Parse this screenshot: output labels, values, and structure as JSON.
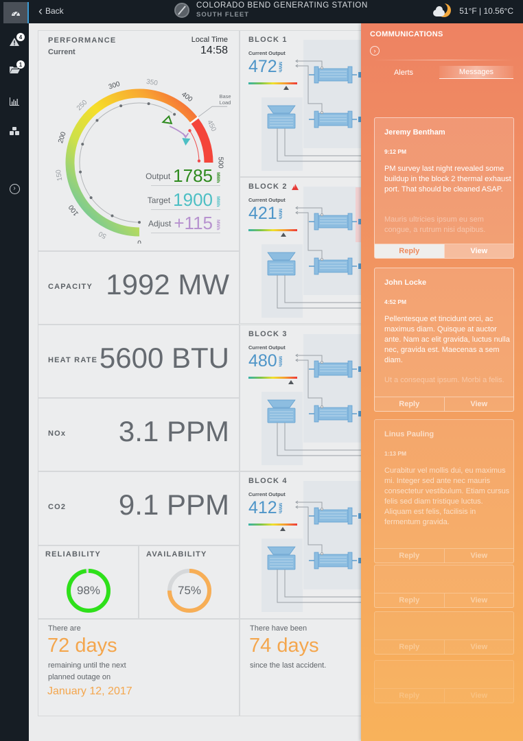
{
  "topbar": {
    "back_label": "Back",
    "station_name": "COLORADO BEND GENERATING STATION",
    "fleet_name": "SOUTH FLEET",
    "weather_icon": "partly-cloudy-night-icon",
    "temperature": "51°F | 10.56°C"
  },
  "sidebar": {
    "items": [
      {
        "icon": "dashboard-gauge-icon",
        "active": true
      },
      {
        "icon": "alert-triangle-icon",
        "badge": "4"
      },
      {
        "icon": "folder-icon",
        "badge": "1"
      },
      {
        "icon": "bar-chart-icon"
      },
      {
        "icon": "cubes-icon"
      },
      {
        "icon": "expand-chevron-icon"
      }
    ]
  },
  "performance": {
    "title": "PERFORMANCE",
    "subtitle": "Current",
    "local_time_label": "Local Time",
    "local_time": "14:58",
    "gauge": {
      "min": 0,
      "max": 500,
      "ticks": [
        "0",
        "50",
        "100",
        "150",
        "200",
        "250",
        "300",
        "350",
        "400",
        "450",
        "500"
      ],
      "base_load_label": "Base\nLoad",
      "base_load_value": 430,
      "current_marker": 395,
      "target_marker": 455
    },
    "output_label": "Output",
    "output_value": "1785",
    "output_unit": "MWh",
    "target_label": "Target",
    "target_value": "1900",
    "target_unit": "MWh",
    "adjust_label": "Adjust",
    "adjust_value": "+115",
    "adjust_unit": "MWh",
    "colors": {
      "output": "#2e8a1e",
      "target": "#4dbfc4",
      "adjust": "#b792cf"
    }
  },
  "kpis": {
    "capacity_label": "CAPACITY",
    "capacity_value": "1992 MW",
    "heat_rate_label": "HEAT RATE",
    "heat_rate_value": "5600 BTU",
    "nox_label": "NOx",
    "nox_value": "3.1 PPM",
    "co2_label": "CO2",
    "co2_value": "9.1 PPM"
  },
  "reliability": {
    "label": "RELIABILITY",
    "value": "98%",
    "fraction": 0.98,
    "color": "#2ee01a"
  },
  "availability": {
    "label": "AVAILABILITY",
    "value": "75%",
    "fraction": 0.75,
    "color": "#f7ae56"
  },
  "outage": {
    "pre": "There are",
    "days": "72 days",
    "post_line1": "remaining until the next",
    "post_line2": "planned outage on",
    "date": "January 12, 2017"
  },
  "safety": {
    "pre": "There have been",
    "days": "74 days",
    "post": "since the last accident."
  },
  "blocks": [
    {
      "title": "BLOCK 1",
      "current_output_label": "Current Output",
      "value": "472",
      "unit": "MWh",
      "marker": 0.78,
      "warning": false
    },
    {
      "title": "BLOCK 2",
      "current_output_label": "Current Output",
      "value": "421",
      "unit": "MWh",
      "marker": 0.72,
      "warning": true
    },
    {
      "title": "BLOCK 3",
      "current_output_label": "Current Output",
      "value": "480",
      "unit": "MWh",
      "marker": 0.88,
      "warning": false
    },
    {
      "title": "BLOCK 4",
      "current_output_label": "Current Output",
      "value": "412",
      "unit": "MWh",
      "marker": 0.7,
      "warning": false
    }
  ],
  "communications": {
    "title": "COMMUNICATIONS",
    "tabs": [
      "Alerts",
      "Messages"
    ],
    "active_tab": "Messages",
    "messages": [
      {
        "name": "Jeremy Bentham",
        "time": "9:12 PM",
        "body": "PM survey last night revealed some buildup in the block 2 thermal exhaust port. That should be cleaned ASAP.",
        "faded": "Mauris ultricies ipsum eu sem congue, a rutrum nisi dapibus.",
        "reply": "Reply",
        "view": "View"
      },
      {
        "name": "John Locke",
        "time": "4:52 PM",
        "body": "Pellentesque et tincidunt orci, ac maximus diam. Quisque at auctor ante. Nam ac elit gravida, luctus nulla nec, gravida est. Maecenas a sem diam.",
        "faded": "Ut a consequat ipsum. Morbi a felis.",
        "reply": "Reply",
        "view": "View"
      },
      {
        "name": "Linus Pauling",
        "time": "1:13 PM",
        "body": "Curabitur vel mollis dui, eu maximus mi. Integer sed ante nec mauris consectetur vestibulum. Etiam cursus felis sed diam tristique luctus. Aliquam est felis, facilisis in fermentum gravida.",
        "faded": "",
        "reply": "Reply",
        "view": "View"
      },
      {
        "reply": "Reply",
        "view": "View"
      },
      {
        "reply": "Reply",
        "view": "View"
      },
      {
        "reply": "Reply",
        "view": "View"
      }
    ]
  }
}
